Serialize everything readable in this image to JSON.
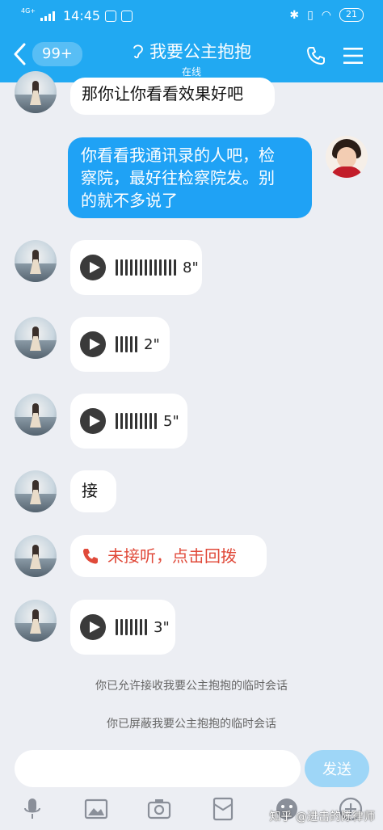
{
  "status_bar": {
    "network": "4G+",
    "time": "14:45",
    "battery": "21"
  },
  "header": {
    "unread_count": "99+",
    "title": "我要公主抱抱",
    "subtitle": "在线",
    "accent": "#21a9f2"
  },
  "messages": [
    {
      "direction": "in",
      "type": "text",
      "text": "那你让你看看效果好吧"
    },
    {
      "direction": "out",
      "type": "text",
      "lines": [
        "你看看我通讯录的人吧，检",
        "察院，最好往检察院发。别",
        "的就不多说了"
      ]
    },
    {
      "direction": "in",
      "type": "voice",
      "duration": "8\""
    },
    {
      "direction": "in",
      "type": "voice",
      "duration": "2\""
    },
    {
      "direction": "in",
      "type": "voice",
      "duration": "5\""
    },
    {
      "direction": "in",
      "type": "text",
      "text": "接"
    },
    {
      "direction": "in",
      "type": "missed_call",
      "text": "未接听，点击回拨"
    },
    {
      "direction": "in",
      "type": "voice",
      "duration": "3\""
    }
  ],
  "system_notes": [
    "你已允许接收我要公主抱抱的临时会话",
    "你已屏蔽我要公主抱抱的临时会话"
  ],
  "composer": {
    "input_value": "",
    "send_label": "发送"
  },
  "toolbar_icons": [
    "microphone-icon",
    "image-icon",
    "camera-icon",
    "red-packet-icon",
    "emoji-icon",
    "more-icon"
  ],
  "watermark": "知乎 @进击的陈律师"
}
